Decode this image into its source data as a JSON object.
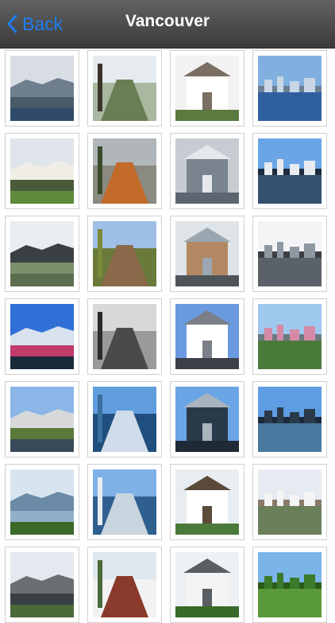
{
  "navbar": {
    "back_label": "Back",
    "title": "Vancouver"
  },
  "photos": [
    {
      "id": "skyline-bay",
      "palette": [
        "#d8dde4",
        "#6f7f8f",
        "#4a5a6a",
        "#2f4a6a"
      ]
    },
    {
      "id": "park-tree",
      "palette": [
        "#e6ebef",
        "#6a7e54",
        "#a9b8a0",
        "#3c3428"
      ]
    },
    {
      "id": "white-church",
      "palette": [
        "#f2f2f2",
        "#ffffff",
        "#7a6f62",
        "#5a7a40"
      ]
    },
    {
      "id": "harbour-skyline",
      "palette": [
        "#7fb0e0",
        "#c9d6e6",
        "#2f5f9f",
        "#6b7f96"
      ]
    },
    {
      "id": "house-lawn",
      "palette": [
        "#dfe5ea",
        "#f0ede6",
        "#4a5a3a",
        "#5f8a3a"
      ]
    },
    {
      "id": "autumn-path",
      "palette": [
        "#b0b6ba",
        "#c26a2a",
        "#8a8a80",
        "#3a4a2a"
      ]
    },
    {
      "id": "snowy-shore",
      "palette": [
        "#c7ccd2",
        "#7a848e",
        "#e4e8ec",
        "#5c6670"
      ]
    },
    {
      "id": "bc-place",
      "palette": [
        "#6aa6e6",
        "#e7eaee",
        "#33506e",
        "#1c2b3d"
      ]
    },
    {
      "id": "rail-street",
      "palette": [
        "#e9edf1",
        "#3a3f44",
        "#7a8f6a",
        "#5b6d4e"
      ]
    },
    {
      "id": "field-buildings",
      "palette": [
        "#9fc0e6",
        "#8a6a4a",
        "#6a7a3a",
        "#7a8a3a"
      ]
    },
    {
      "id": "towers-street",
      "palette": [
        "#dfe4e8",
        "#b18862",
        "#9aa7b0",
        "#4d545a"
      ]
    },
    {
      "id": "glass-towers",
      "palette": [
        "#f4f4f6",
        "#8e98a1",
        "#5a6168",
        "#3a3f44"
      ]
    },
    {
      "id": "science-world",
      "palette": [
        "#2f6fd6",
        "#d8e2ee",
        "#c03a6a",
        "#1a2a3a"
      ]
    },
    {
      "id": "bare-trees-bw",
      "palette": [
        "#d8d8d8",
        "#4a4a4a",
        "#9a9a9a",
        "#2a2a2a"
      ]
    },
    {
      "id": "mountain-road",
      "palette": [
        "#6a9be0",
        "#ffffff",
        "#7a7f88",
        "#3a3f48"
      ]
    },
    {
      "id": "cherry-blossom",
      "palette": [
        "#9fc8ef",
        "#d48aa6",
        "#4a7a3a",
        "#6a7a80"
      ]
    },
    {
      "id": "waterfront-park",
      "palette": [
        "#8ab6e8",
        "#d6d8da",
        "#5a7a3a",
        "#3a4a5a"
      ]
    },
    {
      "id": "false-creek",
      "palette": [
        "#5f9ddd",
        "#d0dcea",
        "#204f7f",
        "#3a6f9f"
      ]
    },
    {
      "id": "tower-marina",
      "palette": [
        "#6aa6e6",
        "#2a3a4a",
        "#aab4be",
        "#1e2a36"
      ]
    },
    {
      "id": "burrard-bridge",
      "palette": [
        "#5f9de2",
        "#2a3a4a",
        "#4a7aa0",
        "#1a2a3a"
      ]
    },
    {
      "id": "harbour-green",
      "palette": [
        "#d8e4f0",
        "#6a8aa6",
        "#8fb0c8",
        "#3a6a2a"
      ]
    },
    {
      "id": "marina-boats",
      "palette": [
        "#7fb0e6",
        "#c8d4de",
        "#2f5f8f",
        "#e8ecf0"
      ]
    },
    {
      "id": "craftsman-house",
      "palette": [
        "#e8edf2",
        "#ffffff",
        "#5a4a3a",
        "#4a7a3a"
      ]
    },
    {
      "id": "modern-house",
      "palette": [
        "#e6ebf1",
        "#f4f4f4",
        "#6a7f5a",
        "#8a7a6a"
      ]
    },
    {
      "id": "suburban-house",
      "palette": [
        "#e4e9ef",
        "#6a6f74",
        "#3a3f44",
        "#4a6a3a"
      ]
    },
    {
      "id": "red-house",
      "palette": [
        "#dfe6ee",
        "#8a3a2a",
        "#f2f2f2",
        "#4a6a3a"
      ]
    },
    {
      "id": "white-house",
      "palette": [
        "#eef1f4",
        "#f4f4f4",
        "#5a5f64",
        "#3a6a2a"
      ]
    },
    {
      "id": "green-trees",
      "palette": [
        "#7ab4e8",
        "#3a7a2a",
        "#5a9a3a",
        "#2a5a1a"
      ]
    }
  ]
}
